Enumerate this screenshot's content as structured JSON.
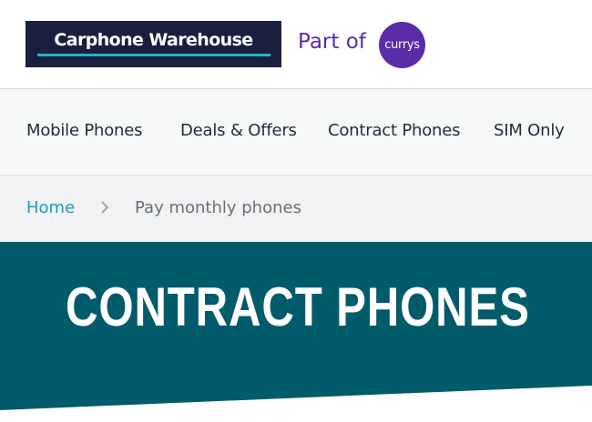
{
  "header": {
    "brand": "Carphone Warehouse",
    "part_of": "Part of",
    "partner_badge": "currys",
    "colors": {
      "brand_navy": "#1a1f3f",
      "brand_accent": "#1fb6c9",
      "partner_purple": "#5a2ca8"
    }
  },
  "nav": {
    "items": [
      {
        "label": "Mobile Phones"
      },
      {
        "label": "Deals & Offers"
      },
      {
        "label": "Contract Phones"
      },
      {
        "label": "SIM Only"
      }
    ]
  },
  "breadcrumb": {
    "home": "Home",
    "separator_icon": "chevron-right-icon",
    "current": "Pay monthly phones"
  },
  "hero": {
    "title": "CONTRACT PHONES",
    "background": "#015b6b"
  }
}
